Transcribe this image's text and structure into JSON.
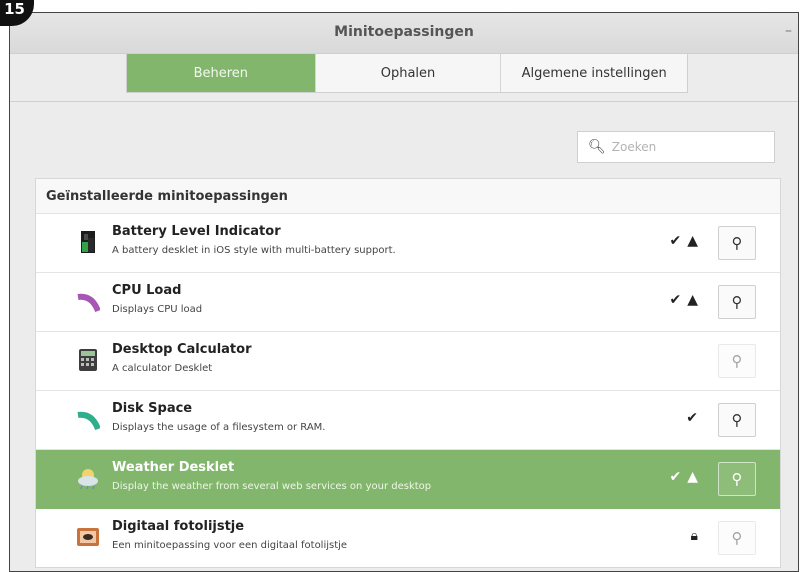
{
  "badge": "15",
  "window": {
    "title": "Minitoepassingen",
    "minimize_glyph": "–"
  },
  "tabs": [
    {
      "label": "Beheren",
      "active": true
    },
    {
      "label": "Ophalen",
      "active": false
    },
    {
      "label": "Algemene instellingen",
      "active": false
    }
  ],
  "search": {
    "placeholder": "Zoeken",
    "value": "",
    "icon": "search-icon"
  },
  "list": {
    "header": "Geïnstalleerde minitoepassingen",
    "items": [
      {
        "name": "Battery Level Indicator",
        "description": "A battery desklet in iOS style with multi-battery support.",
        "status": [
          "check-icon",
          "warning-icon"
        ],
        "icon": "battery-icon",
        "configurable": true,
        "selected": false
      },
      {
        "name": "CPU Load",
        "description": "Displays CPU load",
        "status": [
          "check-icon",
          "warning-icon"
        ],
        "icon": "cpu-arc-icon",
        "configurable": true,
        "selected": false
      },
      {
        "name": "Desktop Calculator",
        "description": "A calculator Desklet",
        "status": [],
        "icon": "calculator-icon",
        "configurable": false,
        "selected": false
      },
      {
        "name": "Disk Space",
        "description": "Displays the usage of a filesystem or RAM.",
        "status": [
          "check-icon"
        ],
        "icon": "disk-arc-icon",
        "configurable": true,
        "selected": false
      },
      {
        "name": "Weather Desklet",
        "description": "Display the weather from several web services on your desktop",
        "status": [
          "check-icon",
          "warning-icon"
        ],
        "icon": "weather-icon",
        "configurable": true,
        "selected": true
      },
      {
        "name": "Digitaal fotolijstje",
        "description": "Een minitoepassing voor een digitaal fotolijstje",
        "status": [
          "lock-icon"
        ],
        "icon": "photo-frame-icon",
        "configurable": false,
        "selected": false
      }
    ]
  },
  "colors": {
    "accent": "#83b66d",
    "purple_arc": "#a557b3",
    "teal_arc": "#2fae8c"
  }
}
